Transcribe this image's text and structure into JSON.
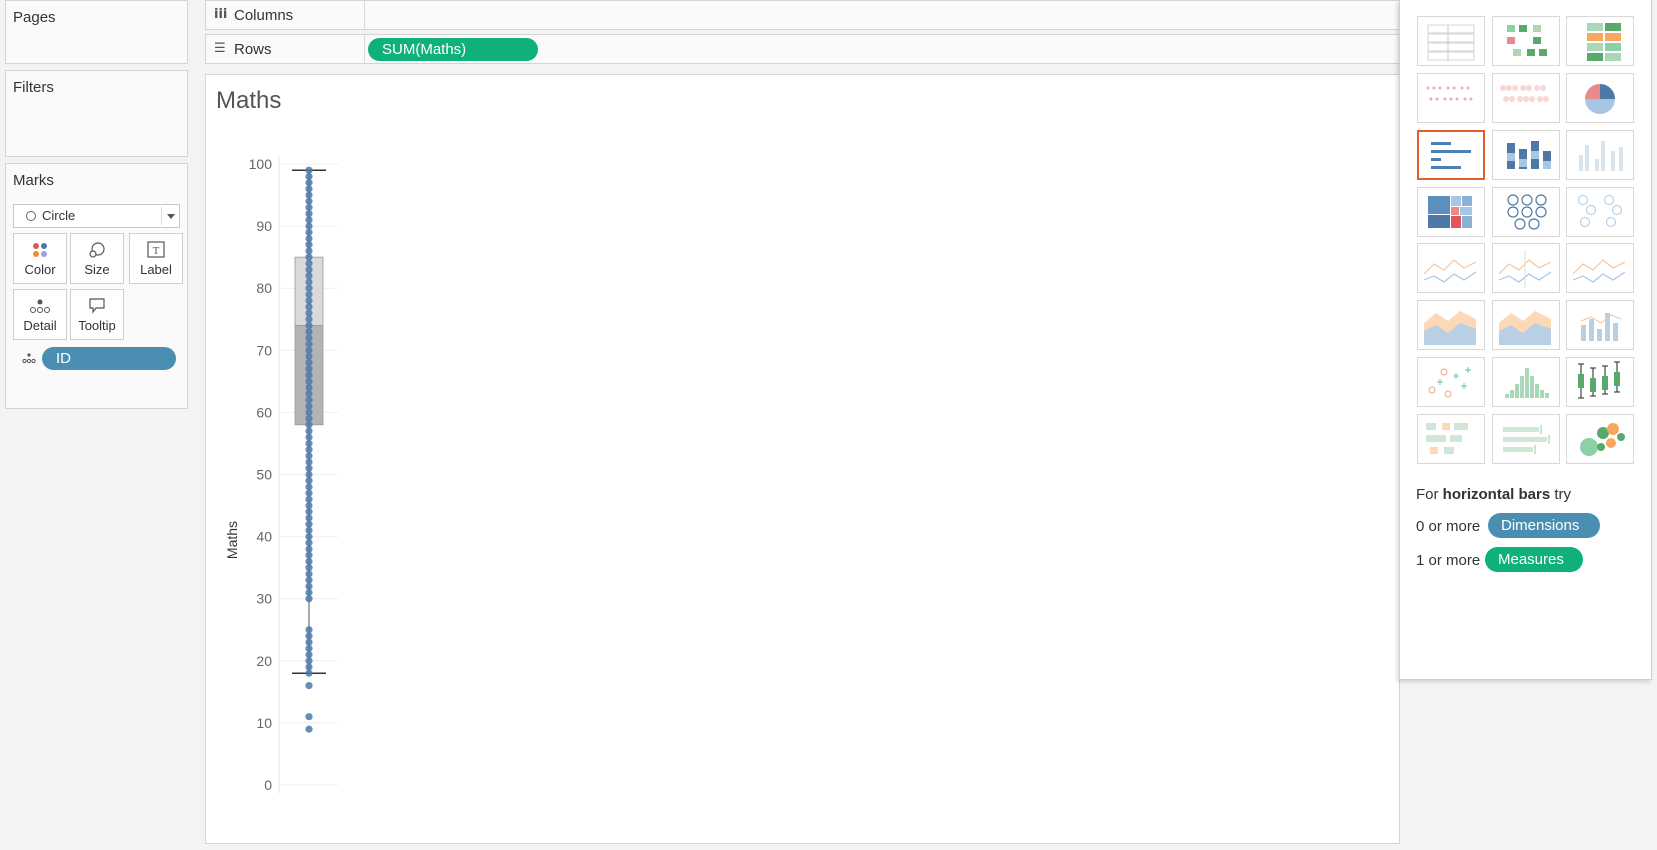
{
  "cards": {
    "pages_title": "Pages",
    "filters_title": "Filters",
    "marks_title": "Marks"
  },
  "shelves": {
    "columns_label": "Columns",
    "columns_icon": "iii",
    "rows_label": "Rows",
    "rows_icon": "☰",
    "rows_pill": "SUM(Maths)"
  },
  "marks": {
    "type": "Circle",
    "buttons": [
      "Color",
      "Size",
      "Label",
      "Detail",
      "Tooltip"
    ],
    "detail_pill": "ID"
  },
  "chart_data": {
    "type": "scatter",
    "title": "Maths",
    "ylabel": "Maths",
    "xlabel": "",
    "ylim": [
      0,
      100
    ],
    "yticks": [
      0,
      10,
      20,
      30,
      40,
      50,
      60,
      70,
      80,
      90,
      100
    ],
    "grid": true,
    "points": [
      9,
      11,
      16,
      18,
      19,
      20,
      21,
      22,
      23,
      24,
      25,
      30,
      31,
      32,
      33,
      34,
      35,
      36,
      37,
      38,
      39,
      40,
      41,
      42,
      43,
      44,
      45,
      46,
      47,
      48,
      49,
      50,
      51,
      52,
      53,
      54,
      55,
      56,
      57,
      58,
      59,
      60,
      61,
      62,
      63,
      64,
      65,
      66,
      67,
      68,
      69,
      70,
      71,
      72,
      73,
      74,
      75,
      76,
      77,
      78,
      79,
      80,
      81,
      82,
      83,
      84,
      85,
      86,
      87,
      88,
      89,
      90,
      91,
      92,
      93,
      94,
      95,
      96,
      97,
      98,
      99
    ],
    "boxplot": {
      "whisker_low": 18,
      "q1": 58,
      "median": 74,
      "q3": 85,
      "whisker_high": 99
    },
    "point_color": "#4e79a7"
  },
  "showme": {
    "selected_index": 6,
    "hint_prefix": "For ",
    "hint_bold": "horizontal bars",
    "hint_suffix": " try",
    "dims_text": "0 or more",
    "dims_pill": "Dimensions",
    "measures_text": "1 or more",
    "measures_pill": "Measures",
    "chart_types": [
      "text-table-icon",
      "heat-map-icon",
      "highlight-table-icon",
      "symbol-map-icon",
      "filled-map-icon",
      "pie-chart-icon",
      "horizontal-bars-icon",
      "stacked-bars-icon",
      "side-by-side-bars-icon",
      "treemap-icon",
      "circle-views-icon",
      "side-by-side-circles-icon",
      "lines-continuous-icon",
      "lines-discrete-icon",
      "dual-lines-icon",
      "area-continuous-icon",
      "area-discrete-icon",
      "dual-combination-icon",
      "scatter-plot-icon",
      "histogram-icon",
      "box-whisker-icon",
      "gantt-chart-icon",
      "bullet-graph-icon",
      "packed-bubbles-icon"
    ]
  },
  "colors": {
    "measure_green": "#0fb07b",
    "dimension_blue": "#4a8fb1",
    "selected_orange": "#e0602e"
  }
}
